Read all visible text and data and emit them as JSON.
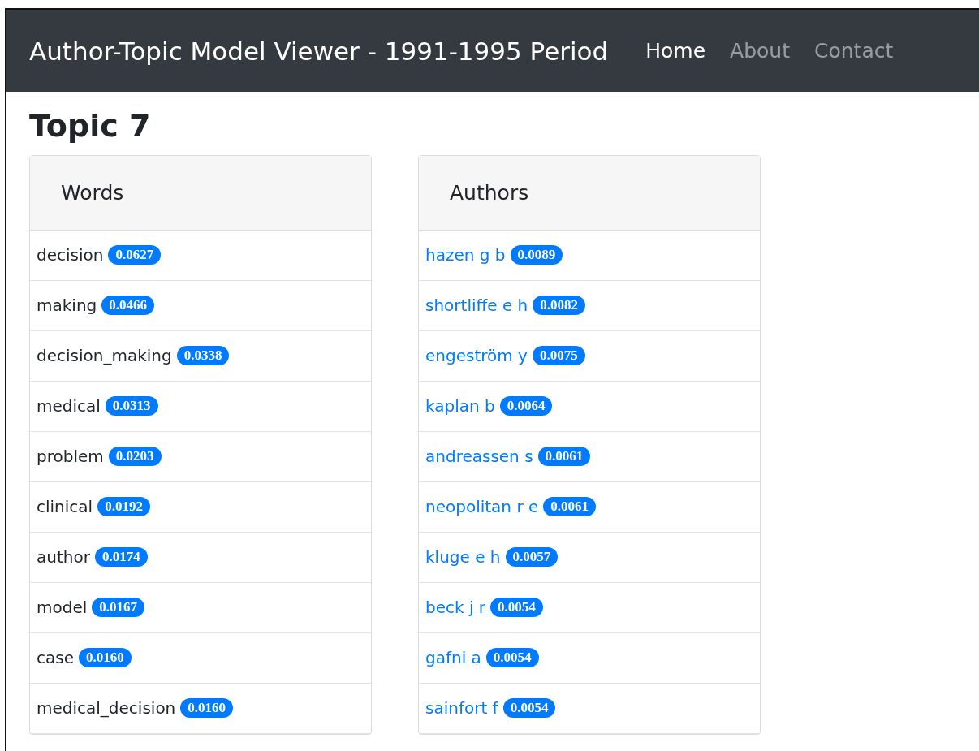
{
  "navbar": {
    "brand": "Author-Topic Model Viewer - 1991-1995 Period",
    "links": [
      {
        "label": "Home",
        "selected": true
      },
      {
        "label": "About",
        "selected": false
      },
      {
        "label": "Contact",
        "selected": false
      }
    ]
  },
  "heading": "Topic 7",
  "cards": [
    {
      "title": "Words",
      "kind": "text",
      "items": [
        {
          "label": "decision",
          "score": "0.0627"
        },
        {
          "label": "making",
          "score": "0.0466"
        },
        {
          "label": "decision_making",
          "score": "0.0338"
        },
        {
          "label": "medical",
          "score": "0.0313"
        },
        {
          "label": "problem",
          "score": "0.0203"
        },
        {
          "label": "clinical",
          "score": "0.0192"
        },
        {
          "label": "author",
          "score": "0.0174"
        },
        {
          "label": "model",
          "score": "0.0167"
        },
        {
          "label": "case",
          "score": "0.0160"
        },
        {
          "label": "medical_decision",
          "score": "0.0160"
        }
      ]
    },
    {
      "title": "Authors",
      "kind": "link",
      "items": [
        {
          "label": "hazen g b",
          "score": "0.0089"
        },
        {
          "label": "shortliffe e h",
          "score": "0.0082"
        },
        {
          "label": "engeström y",
          "score": "0.0075"
        },
        {
          "label": "kaplan b",
          "score": "0.0064"
        },
        {
          "label": "andreassen s",
          "score": "0.0061"
        },
        {
          "label": "neopolitan r e",
          "score": "0.0061"
        },
        {
          "label": "kluge e h",
          "score": "0.0057"
        },
        {
          "label": "beck j r",
          "score": "0.0054"
        },
        {
          "label": "gafni a",
          "score": "0.0054"
        },
        {
          "label": "sainfort f",
          "score": "0.0054"
        }
      ]
    }
  ]
}
